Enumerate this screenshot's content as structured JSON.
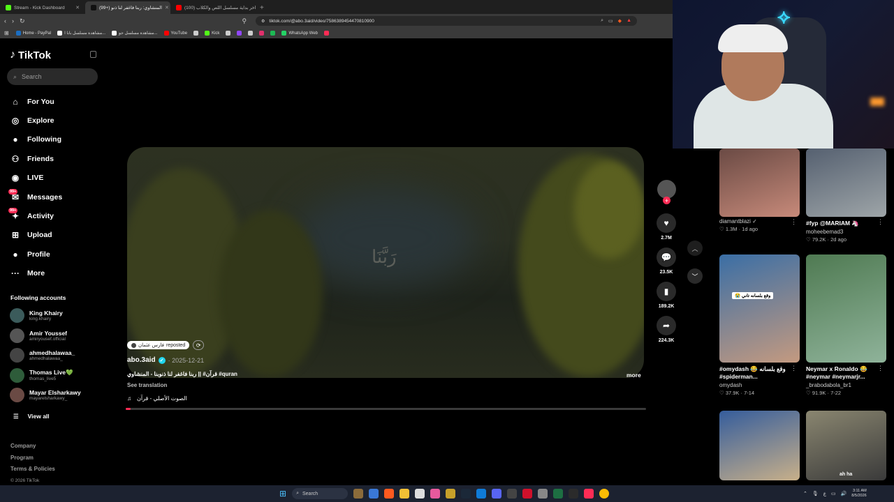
{
  "browser": {
    "tabs": [
      {
        "label": "Stream - Kick Dashboard",
        "color": "#53fc18",
        "active": false
      },
      {
        "label": "(99+) المنشاوي: ربنا فاغفر لنا ذنو",
        "color": "#111111",
        "active": true
      },
      {
        "label": "(100) اخر بداية مسلسل اللص والكلاب",
        "color": "#ff0000",
        "active": false
      }
    ],
    "url": "tiktok.com/@abo.3aid/video/7586389454470810900",
    "bookmarks": [
      {
        "label": "Home - PayPal",
        "color": "#1b6ec2"
      },
      {
        "label": "مشاهدة مسلسل بابا ا...",
        "color": "#ffffff"
      },
      {
        "label": "مشاهدة مسلسل جو...",
        "color": "#ffffff"
      },
      {
        "label": "YouTube",
        "color": "#ff0000"
      },
      {
        "label": "",
        "color": "#cccccc"
      },
      {
        "label": "Kick",
        "color": "#53fc18"
      },
      {
        "label": "",
        "color": "#cccccc"
      },
      {
        "label": "",
        "color": "#9146ff"
      },
      {
        "label": "",
        "color": "#cccccc"
      },
      {
        "label": "",
        "color": "#e1306c"
      },
      {
        "label": "",
        "color": "#1db954"
      },
      {
        "label": "WhatsApp Web",
        "color": "#25d366"
      },
      {
        "label": "",
        "color": "#fe2c55"
      }
    ]
  },
  "tiktok": {
    "logo_text": "TikTok",
    "search_placeholder": "Search",
    "menu": [
      {
        "label": "For You",
        "icon": "home-icon"
      },
      {
        "label": "Explore",
        "icon": "compass-icon"
      },
      {
        "label": "Following",
        "icon": "following-icon"
      },
      {
        "label": "Friends",
        "icon": "friends-icon"
      },
      {
        "label": "LIVE",
        "icon": "live-icon"
      },
      {
        "label": "Messages",
        "icon": "messages-icon",
        "badge": "99+"
      },
      {
        "label": "Activity",
        "icon": "activity-icon",
        "badge": "99+"
      },
      {
        "label": "Upload",
        "icon": "upload-icon"
      },
      {
        "label": "Profile",
        "icon": "profile-icon"
      },
      {
        "label": "More",
        "icon": "more-icon"
      }
    ],
    "following_title": "Following accounts",
    "following": [
      {
        "name": "King Khairy",
        "handle": "king.khairy"
      },
      {
        "name": "Amir Youssef",
        "handle": "amiryousef.official"
      },
      {
        "name": "ahmedhalawaa_",
        "handle": "ahmedhalawaa_"
      },
      {
        "name": "Thomas Live💚",
        "handle": "thomas_live5"
      },
      {
        "name": "Mayar Elsharkawy",
        "handle": "mayarelsharkawy_"
      }
    ],
    "view_all": "View all",
    "footer": [
      "Company",
      "Program",
      "Terms & Policies"
    ],
    "copyright": "© 2026 TikTok"
  },
  "video": {
    "overlay_text": "رَبَّنَا",
    "repost_user": "فارس عثمان",
    "repost_label": "reposted",
    "author": "abo.3aid",
    "date": "2025-12-21",
    "caption": "قرآن# || ربنا فاغفر لنا ذنوبنا - المنشاوي #quran",
    "see_translation": "See translation",
    "sound": "الصوت الأصلي - قرآن",
    "more": "more",
    "progress": 0.01,
    "likes": "2.7M",
    "comments": "23.5K",
    "saves": "189.2K",
    "shares": "224.3K"
  },
  "recommendations": [
    {
      "title": "",
      "author": "diamantblazi",
      "verified": true,
      "stats": "1.3M · 1d ago",
      "c1": "#6a4a44",
      "c2": "#c78a7a"
    },
    {
      "title": "#fyp @MARIAM 🦄",
      "author": "moheebemad3",
      "verified": false,
      "stats": "79.2K · 2d ago",
      "c1": "#556070",
      "c2": "#9ea5a8"
    },
    {
      "title": "#omydash 😂 وقع بلسانه #spiderman...",
      "author": "omydash",
      "verified": false,
      "stats": "37.9K · 7-14",
      "c1": "#3a6ea5",
      "c2": "#c49a80",
      "sticker": "😭 وقع بلسانه تاني"
    },
    {
      "title": "Neymar x Ronaldo 😂 #neymar #neymarjr...",
      "author": "_brabodabola_br1",
      "verified": false,
      "stats": "91.9K · 7-22",
      "c1": "#4f7a52",
      "c2": "#8fb39a"
    },
    {
      "title": "",
      "author": "",
      "verified": false,
      "stats": "",
      "c1": "#355d9c",
      "c2": "#c8b08a"
    },
    {
      "title": "",
      "author": "",
      "verified": false,
      "stats": "",
      "c1": "#8a8670",
      "c2": "#3a3a3a",
      "caption": "ah ha"
    }
  ],
  "taskbar": {
    "search": "Search",
    "time": "3:11 AM",
    "date": "8/5/2026"
  }
}
